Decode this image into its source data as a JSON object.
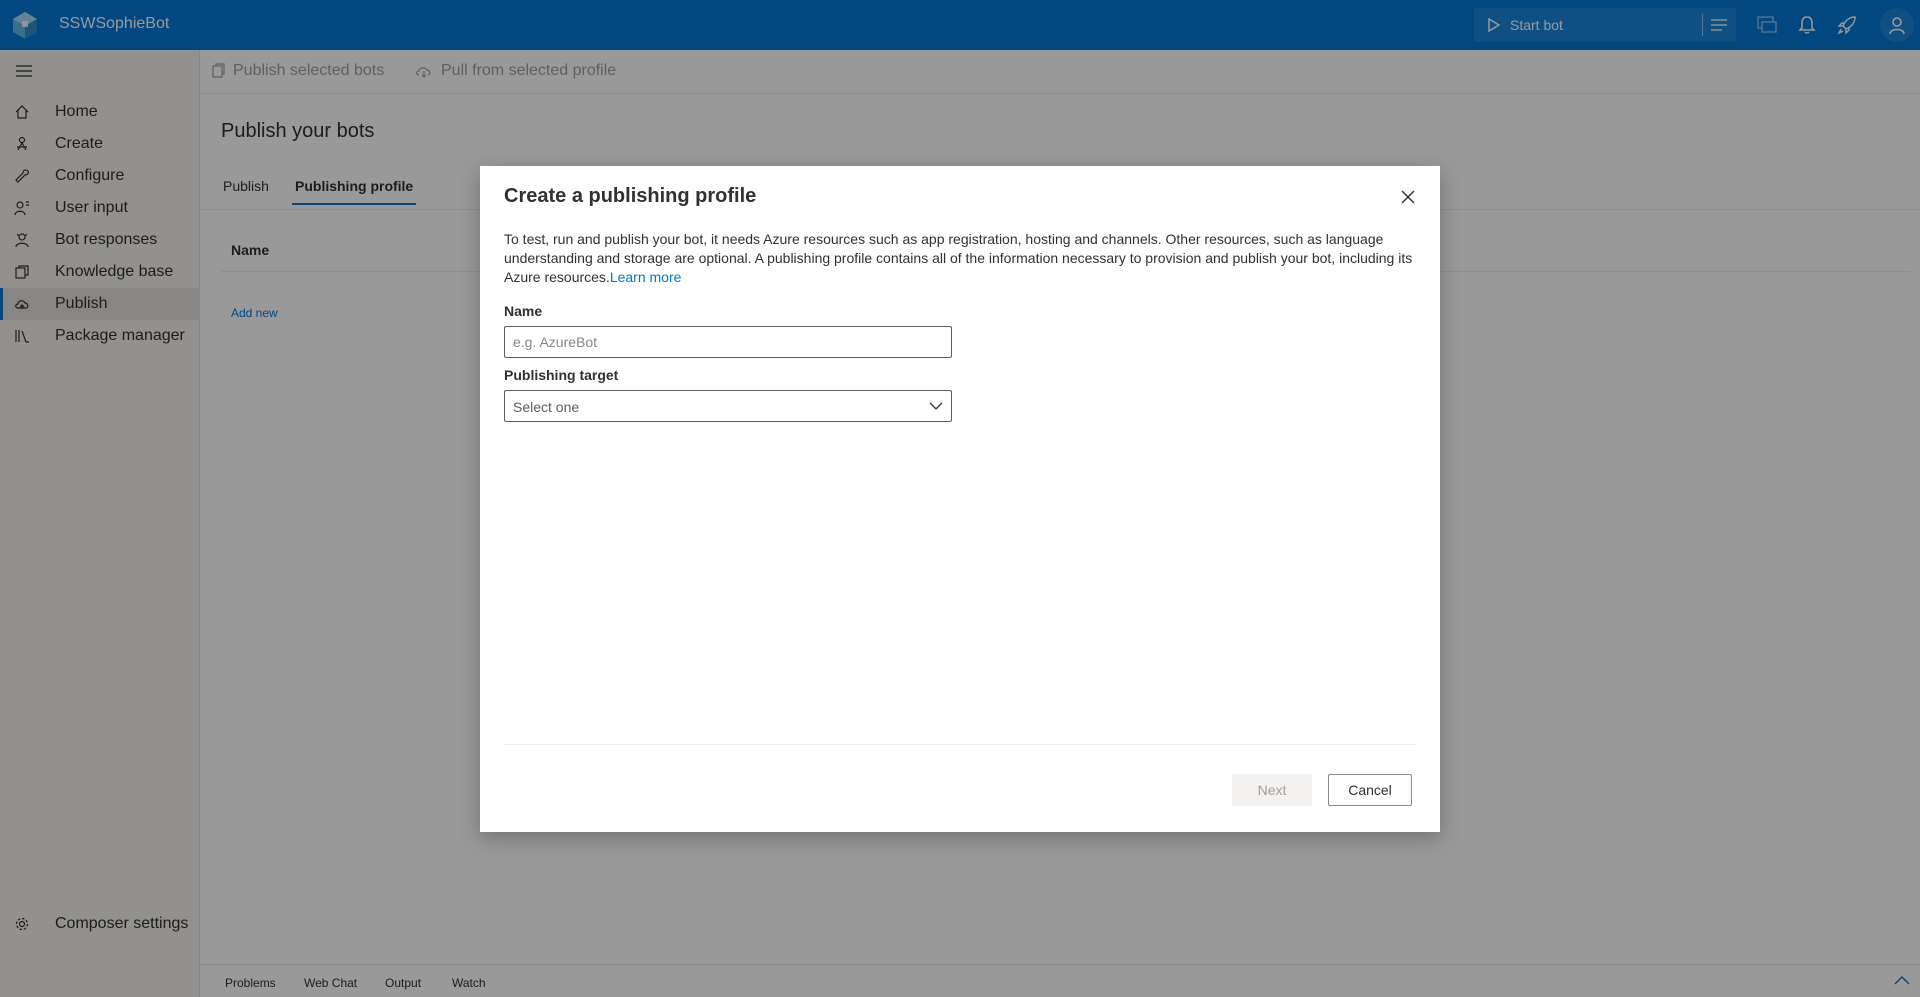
{
  "app": {
    "title": "SSWSophieBot"
  },
  "topbar": {
    "start_bot_label": "Start bot"
  },
  "sidebar": {
    "items": [
      {
        "label": "Home",
        "icon": "home-icon"
      },
      {
        "label": "Create",
        "icon": "create-icon"
      },
      {
        "label": "Configure",
        "icon": "wrench-icon"
      },
      {
        "label": "User input",
        "icon": "user-input-icon"
      },
      {
        "label": "Bot responses",
        "icon": "bot-responses-icon"
      },
      {
        "label": "Knowledge base",
        "icon": "knowledge-base-icon"
      },
      {
        "label": "Publish",
        "icon": "cloud-upload-icon"
      },
      {
        "label": "Package manager",
        "icon": "library-icon"
      }
    ],
    "active_index": 6,
    "settings_label": "Composer settings"
  },
  "toolbar": {
    "publish_selected": "Publish selected bots",
    "pull_selected": "Pull from selected profile"
  },
  "page": {
    "title": "Publish your bots",
    "tabs": [
      {
        "label": "Publish"
      },
      {
        "label": "Publishing profile"
      }
    ],
    "active_tab": 1,
    "table": {
      "column_name": "Name"
    },
    "add_new": "Add new"
  },
  "bottom_panel": {
    "tabs": [
      "Problems",
      "Web Chat",
      "Output",
      "Watch"
    ]
  },
  "dialog": {
    "title": "Create a publishing profile",
    "description": "To test, run and publish your bot, it needs Azure resources such as app registration, hosting and channels. Other resources, such as language understanding and storage are optional. A publishing profile contains all of the information necessary to provision and publish your bot, including its Azure resources.",
    "learn_more": "Learn more",
    "name_label": "Name",
    "name_value": "",
    "name_placeholder": "e.g. AzureBot",
    "target_label": "Publishing target",
    "target_value": "Select one",
    "next_label": "Next",
    "cancel_label": "Cancel"
  },
  "colors": {
    "accent": "#0078d4",
    "topbar": "#0078d4",
    "sidebar_bg": "#f3f2f1"
  }
}
